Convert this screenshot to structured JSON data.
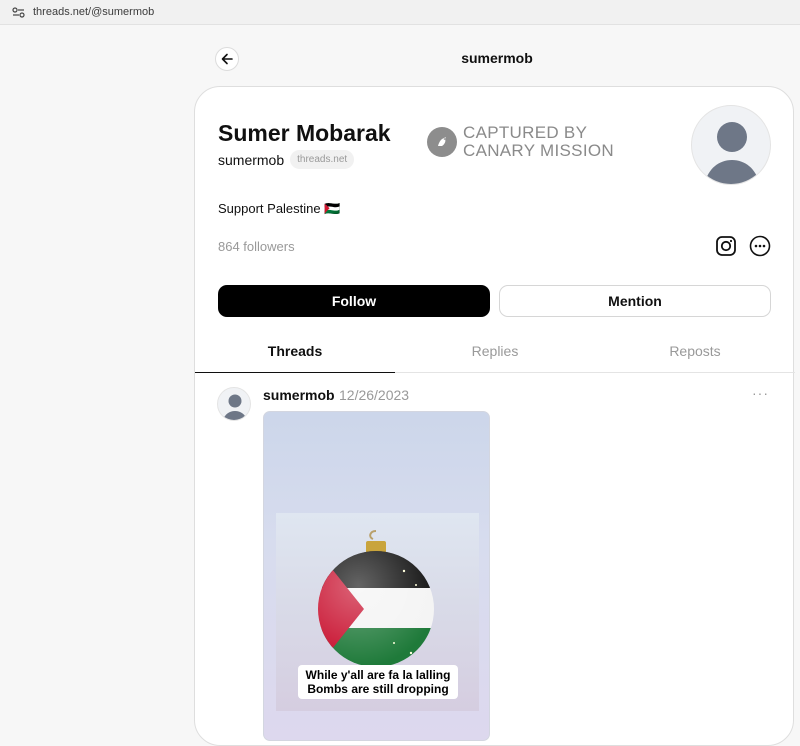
{
  "browser": {
    "url": "threads.net/@sumermob"
  },
  "header": {
    "title": "sumermob"
  },
  "profile": {
    "name": "Sumer Mobarak",
    "handle": "sumermob",
    "domain_badge": "threads.net",
    "bio": "Support Palestine 🇵🇸",
    "followers": "864 followers"
  },
  "watermark": {
    "line1": "CAPTURED BY",
    "line2": "CANARY MISSION"
  },
  "actions": {
    "follow": "Follow",
    "mention": "Mention"
  },
  "tabs": [
    {
      "label": "Threads",
      "active": true
    },
    {
      "label": "Replies",
      "active": false
    },
    {
      "label": "Reposts",
      "active": false
    }
  ],
  "post": {
    "author": "sumermob",
    "date": "12/26/2023",
    "more": "···",
    "image_caption_line1": "While y'all are fa la lalling",
    "image_caption_line2": "Bombs are still dropping"
  },
  "colors": {
    "follow_bg": "#000000",
    "flag_red": "#c8102e",
    "flag_green": "#007a3d"
  }
}
